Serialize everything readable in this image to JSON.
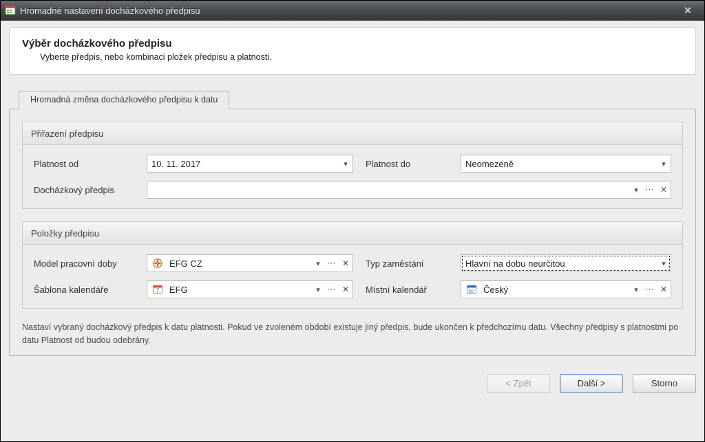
{
  "window": {
    "title": "Hromadné nastavení docházkového předpisu"
  },
  "header": {
    "heading": "Výběr docházkového předpisu",
    "subtext": "Vyberte předpis, nebo kombinaci pložek předpisu a platnosti."
  },
  "tab": {
    "label": "Hromadná změna docházkového předpisu k datu"
  },
  "assignment": {
    "title": "Přiřazení předpisu",
    "valid_from_label": "Platnost od",
    "valid_from_value": "10. 11. 2017",
    "valid_to_label": "Platnost do",
    "valid_to_value": "Neomezeně",
    "attendance_rule_label": "Docházkový předpis",
    "attendance_rule_value": ""
  },
  "items": {
    "title": "Položky předpisu",
    "work_model_label": "Model pracovní doby",
    "work_model_value": "EFG CZ",
    "employment_type_label": "Typ zaměstání",
    "employment_type_value": "Hlavní na dobu neurčitou",
    "calendar_template_label": "Šablona kalendáře",
    "calendar_template_value": "EFG",
    "local_calendar_label": "Místní kalendář",
    "local_calendar_value": "Český"
  },
  "note": "Nastaví vybraný docházkový předpis k datu platnosti. Pokud ve zvoleném období existuje jiný předpis, bude ukončen k předchozímu datu. Všechny předpisy s platnostmi po datu Platnost od budou odebrány.",
  "buttons": {
    "back": "< Zpět",
    "next": "Další >",
    "cancel": "Storno"
  },
  "glyphs": {
    "dropdown": "▾",
    "more": "···",
    "clear": "✕",
    "close": "✕"
  }
}
